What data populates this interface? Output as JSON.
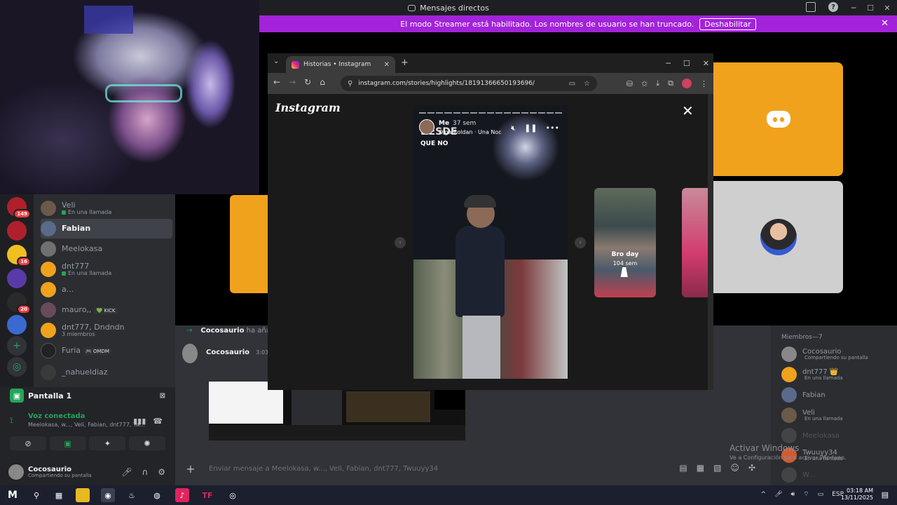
{
  "discord": {
    "window_title": "Mensajes directos",
    "banner": {
      "text": "El modo Streamer está habilitado. Los nombres de usuario se han truncado.",
      "button": "Deshabilitar",
      "close": "✕"
    },
    "server_badges": [
      "149",
      "16",
      "20"
    ],
    "dms": [
      {
        "name": "Veli",
        "sub": "En una llamada",
        "color": "#6b5a4a"
      },
      {
        "name": "Fabian",
        "sub": "",
        "color": "#5a6a8a",
        "active": true
      },
      {
        "name": "Meelokasa",
        "sub": "",
        "color": "#707070"
      },
      {
        "name": "dnt777",
        "sub": "En una llamada",
        "color": "#f0a21d"
      },
      {
        "name": "a...",
        "sub": "",
        "color": "#f0a21d"
      },
      {
        "name": "mauro,,",
        "sub": "",
        "color": "#6a4a5a",
        "tag": "💚 KICK"
      },
      {
        "name": "dnt777, Dndndn",
        "sub": "3 miembros",
        "color": "#f0a21d"
      },
      {
        "name": "Furia",
        "sub": "",
        "color": "#222",
        "tag": "🎮 OMDM"
      },
      {
        "name": "_nahueldiaz",
        "sub": "",
        "color": "#3a3a3a"
      }
    ],
    "voice": {
      "screen_label": "Pantalla 1",
      "status": "Voz conectada",
      "participants": "Meelokasa, w..., Veli, Fabian, dnt777, Tw..."
    },
    "user": {
      "name": "Cocosaurio",
      "status": "Compartiendo su pantalla"
    },
    "chat": {
      "system_msg_author": "Cocosaurio",
      "system_msg_text": "ha aña",
      "msg_author": "Cocosaurio",
      "msg_time": "3:03",
      "composer_placeholder": "Enviar mensaje a Meelokasa, w..., Veli, Fabian, dnt777, Twuuyy34"
    },
    "members": {
      "header": "Miembros—7",
      "list": [
        {
          "name": "Cocosaurio",
          "sub": "Compartiendo su pantalla",
          "color": "#888"
        },
        {
          "name": "dnt777 👑",
          "sub": "En una llamada",
          "color": "#f0a21d"
        },
        {
          "name": "Fabian",
          "sub": "",
          "color": "#5a6a8a"
        },
        {
          "name": "Veli",
          "sub": "En una llamada",
          "color": "#6b5a4a"
        },
        {
          "name": "Meelokasa",
          "sub": "",
          "color": "#707070",
          "dim": true
        },
        {
          "name": "Twuuyy34",
          "sub": "En una llamada",
          "color": "#d05a30"
        },
        {
          "name": "W...",
          "sub": "",
          "color": "#707070",
          "dim": true
        }
      ]
    },
    "watermark": {
      "title": "Activar Windows",
      "sub": "Ve a Configuración para activar Windows."
    }
  },
  "chrome": {
    "tab_title": "Historias • Instagram",
    "url": "instagram.com/stories/highlights/18191366650193696/"
  },
  "instagram": {
    "logo": "Instagram",
    "story": {
      "user": "Me",
      "time": "37 sem",
      "song": "Olga Roldan · Una Noc",
      "overlay_big": "DESDE",
      "overlay_small": "QUE NO"
    },
    "next_highlight": {
      "label": "Bro day",
      "time": "104 sem"
    }
  },
  "taskbar": {
    "tray_lang": "ESP",
    "time": "03:18 AM",
    "date": "13/11/2025"
  }
}
